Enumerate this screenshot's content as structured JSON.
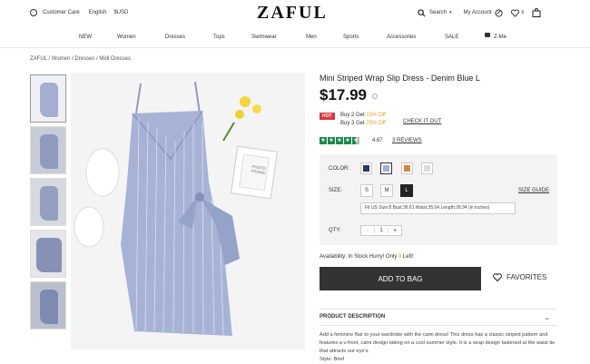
{
  "header": {
    "customer_care": "Customer Care",
    "language": "English",
    "currency": "$USD",
    "logo": "ZAFUL",
    "search": "Search",
    "account": "My Account",
    "cart_count": "6"
  },
  "nav": [
    "NEW",
    "Women",
    "Dresses",
    "Tops",
    "Swimwear",
    "Men",
    "Sports",
    "Accessories",
    "SALE",
    "Z-Me"
  ],
  "breadcrumb": "ZAFUL / Women / Dresses / Midi Dresses",
  "product": {
    "title": "Mini Striped Wrap Slip Dress - Denim Blue L",
    "price": "$17.99",
    "hot": "HOT",
    "promo1": "Buy 2 Get ",
    "promo1b": "15% Off",
    "promo2": "Buy 3 Get ",
    "promo2b": "25% Off",
    "checkout": "CHECK IT OUT",
    "rating": "4.67",
    "reviews": "3 REVIEWS",
    "rating_stars": 4.5,
    "color_label": "COLOR:",
    "colors": [
      "#2b3a6b",
      "#9fb0d6",
      "#d88a3a",
      "#dcdcdc"
    ],
    "size_label": "SIZE:",
    "sizes": [
      "S",
      "M",
      "L"
    ],
    "selected_size": "L",
    "size_guide": "SIZE GUIDE",
    "fit": "Fit US Size:8   Bust:36.61   Waist:35.04   Length:28.94 (in inches)",
    "qty_label": "QTY:",
    "qty_minus": "-",
    "qty": "1",
    "qty_plus": "+",
    "availability": "Availability: In Stock Hurry! Only ",
    "avail_count": "9",
    "avail_end": " Left!",
    "add_to_bag": "ADD TO BAG",
    "favorites": "FAVORITES",
    "desc_title": "PRODUCT DESCRIPTION",
    "description": "Add a feminine flair to your wardrobe with the cami dress! This dress has a classic striped pattern and features a v-front, cami design taking on a cool summer style. It is a wrap design fastened at the waist tie that attracts our eye's.",
    "style": "Style: Brief"
  },
  "photo_frame": "PHOTO FRAME"
}
